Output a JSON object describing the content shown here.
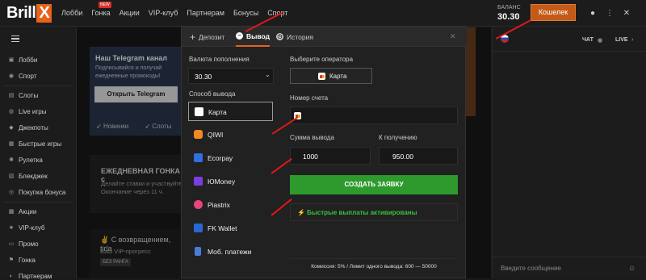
{
  "header": {
    "logo": "Brill",
    "logo_mark": "X",
    "nav": [
      "Лобби",
      "Гонка",
      "Акции",
      "VIP-клуб",
      "Партнерам",
      "Бонусы",
      "Спорт"
    ],
    "new_badge": "NEW",
    "balance_label": "БАЛАНС",
    "balance_value": "30.30",
    "wallet_label": "Кошелек"
  },
  "sidebar": {
    "items_top": [
      "Лобби",
      "Спорт"
    ],
    "items_games": [
      "Слоты",
      "Live игры",
      "Джекпоты",
      "Быстрые игры",
      "Рулетка",
      "Блекджек",
      "Покупка бонуса"
    ],
    "items_bottom": [
      "Акции",
      "VIP-клуб",
      "Промо",
      "Гонка",
      "Партнерам"
    ]
  },
  "main": {
    "telegram_title": "Наш Telegram канал",
    "telegram_sub": "Подписывайся и получай ежедневные промокоды!",
    "telegram_btn": "Открыть Telegram",
    "categories": [
      "Новинки",
      "Слоты"
    ],
    "race_title": "ЕЖЕДНЕВНАЯ ГОНКА с",
    "race_sub1": "Делайте ставки и участвуйте",
    "race_sub2": "Окончание через 11 ч.",
    "welcome_title": "✌ С возвращением, tirla",
    "welcome_sub": "Ваш VIP-прогресс",
    "welcome_rank": "БЕЗ РАНГА"
  },
  "chat": {
    "tab_chat": "ЧАТ",
    "tab_live": "LIVE",
    "input_placeholder": "Введите сообщение"
  },
  "modal": {
    "tabs": [
      "Депозит",
      "Вывод",
      "История"
    ],
    "currency_label": "Валюта пополнения",
    "currency_value": "30.30",
    "method_label": "Способ вывода",
    "methods": [
      {
        "name": "Карта",
        "color": "#ffffff"
      },
      {
        "name": "QIWI",
        "color": "#f5891f"
      },
      {
        "name": "Ecorpay",
        "color": "#2f6fe0"
      },
      {
        "name": "ЮMoney",
        "color": "#7a3fe0"
      },
      {
        "name": "Piastrix",
        "color": "#e8457a"
      },
      {
        "name": "FK Wallet",
        "color": "#2b65d8"
      },
      {
        "name": "Моб. платежи",
        "color": "#4a7bd8"
      }
    ],
    "operator_label": "Выберите оператора",
    "operator_value": "Карта",
    "account_label": "Номер счета",
    "amount_label": "Сумма вывода",
    "amount_value": "1000",
    "receive_label": "К получению",
    "receive_value": "950.00",
    "create_btn": "СОЗДАТЬ ЗАЯВКУ",
    "fast_text": "⚡ Быстрые выплаты активированы",
    "footer": "Комиссия: 5% / Лимит одного вывода: 600 — 50000"
  },
  "colors": {
    "accent": "#e8621a",
    "green": "#2e9a2e",
    "annotation": "#e01818"
  }
}
